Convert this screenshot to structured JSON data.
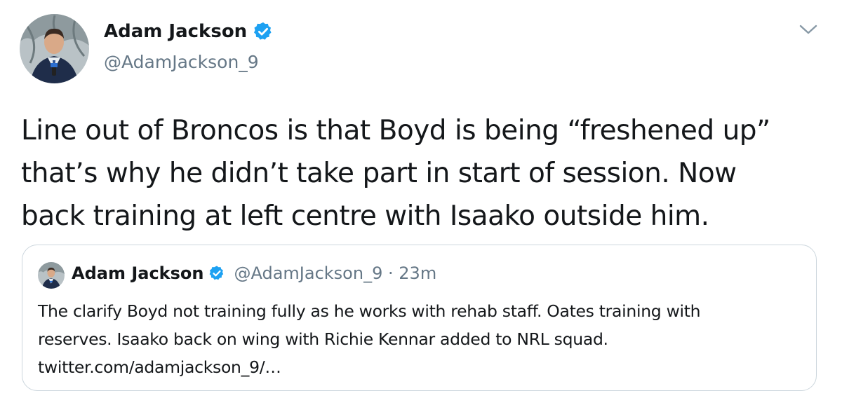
{
  "author": {
    "display_name": "Adam Jackson",
    "handle": "@AdamJackson_9",
    "verified": true
  },
  "tweet": {
    "text_lines": [
      "Line out of Broncos is that Boyd is being “freshened up”",
      "that’s why he didn’t take part in start of session. Now",
      "back training at left centre with Isaako outside him."
    ]
  },
  "quoted_tweet": {
    "display_name": "Adam Jackson",
    "handle": "@AdamJackson_9",
    "separator": "·",
    "time": "23m",
    "text_lines": [
      "The clarify Boyd not training fully as he works with rehab staff. Oates training with",
      "reserves. Isaako back on wing with Richie Kennar added to NRL squad.",
      "twitter.com/adamjackson_9/…"
    ]
  },
  "icons": {
    "verified": "verified-badge-icon",
    "caret": "chevron-down-icon"
  },
  "colors": {
    "verified_blue": "#1da1f2",
    "secondary_text": "#657786",
    "border": "#ccd6dd"
  }
}
